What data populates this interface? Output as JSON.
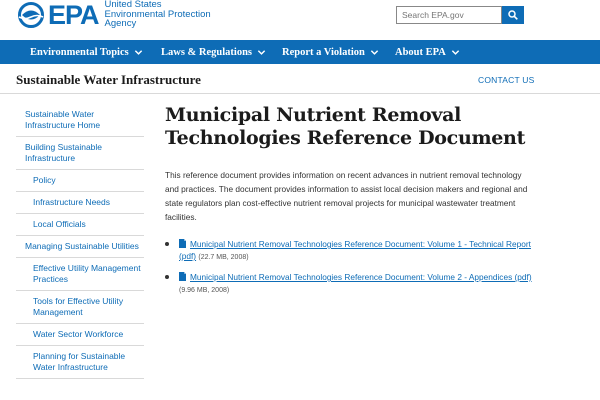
{
  "header": {
    "logo_text": "EPA",
    "logo_subtitle_lines": [
      "United States",
      "Environmental Protection",
      "Agency"
    ],
    "search_placeholder": "Search EPA.gov"
  },
  "nav": {
    "items": [
      {
        "label": "Environmental Topics"
      },
      {
        "label": "Laws & Regulations"
      },
      {
        "label": "Report a Violation"
      },
      {
        "label": "About EPA"
      }
    ]
  },
  "section": {
    "title": "Sustainable Water Infrastructure",
    "contact": "CONTACT US"
  },
  "sidebar": {
    "items": [
      {
        "label": "Sustainable Water Infrastructure Home",
        "sub": false
      },
      {
        "label": "Building Sustainable Infrastructure",
        "sub": false
      },
      {
        "label": "Policy",
        "sub": true
      },
      {
        "label": "Infrastructure Needs",
        "sub": true
      },
      {
        "label": "Local Officials",
        "sub": true
      },
      {
        "label": "Managing Sustainable Utilities",
        "sub": false
      },
      {
        "label": "Effective Utility Management Practices",
        "sub": true
      },
      {
        "label": "Tools for Effective Utility Management",
        "sub": true
      },
      {
        "label": "Water Sector Workforce",
        "sub": true
      },
      {
        "label": "Planning for Sustainable Water Infrastructure",
        "sub": true
      }
    ]
  },
  "main": {
    "title": "Municipal Nutrient Removal Technologies Reference Document",
    "intro": "This reference document provides information on recent advances in nutrient removal technology and practices. The document provides information to assist local decision makers and regional and state regulators plan cost-effective nutrient removal projects for municipal wastewater treatment facilities.",
    "documents": [
      {
        "link": "Municipal Nutrient Removal Technologies Reference Document: Volume 1 - Technical Report (pdf)",
        "meta": "(22.7 MB, 2008)"
      },
      {
        "link": "Municipal Nutrient Removal Technologies Reference Document: Volume 2 - Appendices (pdf)",
        "meta": "(9.96 MB, 2008)"
      }
    ]
  },
  "colors": {
    "brand_blue": "#0e6cb6",
    "text": "#1b1b1b",
    "divider": "#d9d9d9"
  }
}
